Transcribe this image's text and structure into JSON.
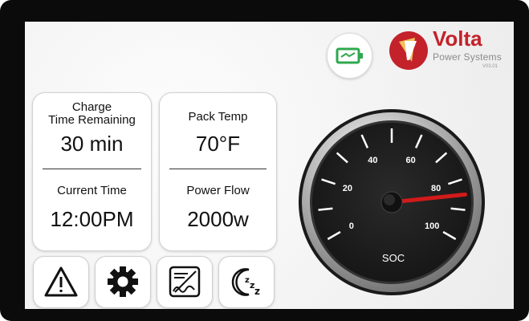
{
  "header": {
    "brand": "Volta",
    "subtitle": "Power Systems",
    "version": "V03.01",
    "battery_icon": "battery-charging-icon",
    "logo_icon": "volta-logo-icon"
  },
  "cards": {
    "charge_label_1": "Charge",
    "charge_label_2": "Time Remaining",
    "charge_value": "30 min",
    "current_time_label": "Current Time",
    "current_time_value": "12:00PM",
    "pack_temp_label": "Pack Temp",
    "pack_temp_value": "70°F",
    "power_flow_label": "Power Flow",
    "power_flow_value": "2000w"
  },
  "buttons": [
    {
      "name": "warning-button",
      "icon": "warning-icon"
    },
    {
      "name": "settings-button",
      "icon": "gear-icon"
    },
    {
      "name": "charge-mode-button",
      "icon": "charge-curve-icon"
    },
    {
      "name": "sleep-button",
      "icon": "sleep-icon"
    }
  ],
  "gauge": {
    "label": "SOC",
    "ticks": [
      "0",
      "20",
      "40",
      "60",
      "80",
      "100"
    ],
    "value": 85,
    "needle_color": "#d11a1a"
  },
  "colors": {
    "accent_red": "#c3222b",
    "battery_green": "#2fa84f"
  }
}
